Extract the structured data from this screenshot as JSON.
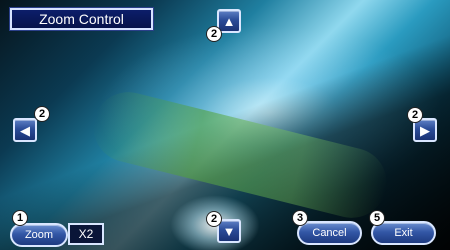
{
  "title": "Zoom Control",
  "zoom": {
    "label": "Zoom",
    "value": "X2"
  },
  "buttons": {
    "cancel": "Cancel",
    "exit": "Exit",
    "up_glyph": "▲",
    "down_glyph": "▼",
    "left_glyph": "◀",
    "right_glyph": "▶"
  },
  "callouts": {
    "zoom": "1",
    "up": "2",
    "down": "2",
    "left": "2",
    "right": "2",
    "cancel": "3",
    "exit": "5"
  },
  "colors": {
    "button_blue": "#3357a6",
    "title_bg": "#0c1e6a",
    "border": "#d9e6ff"
  }
}
